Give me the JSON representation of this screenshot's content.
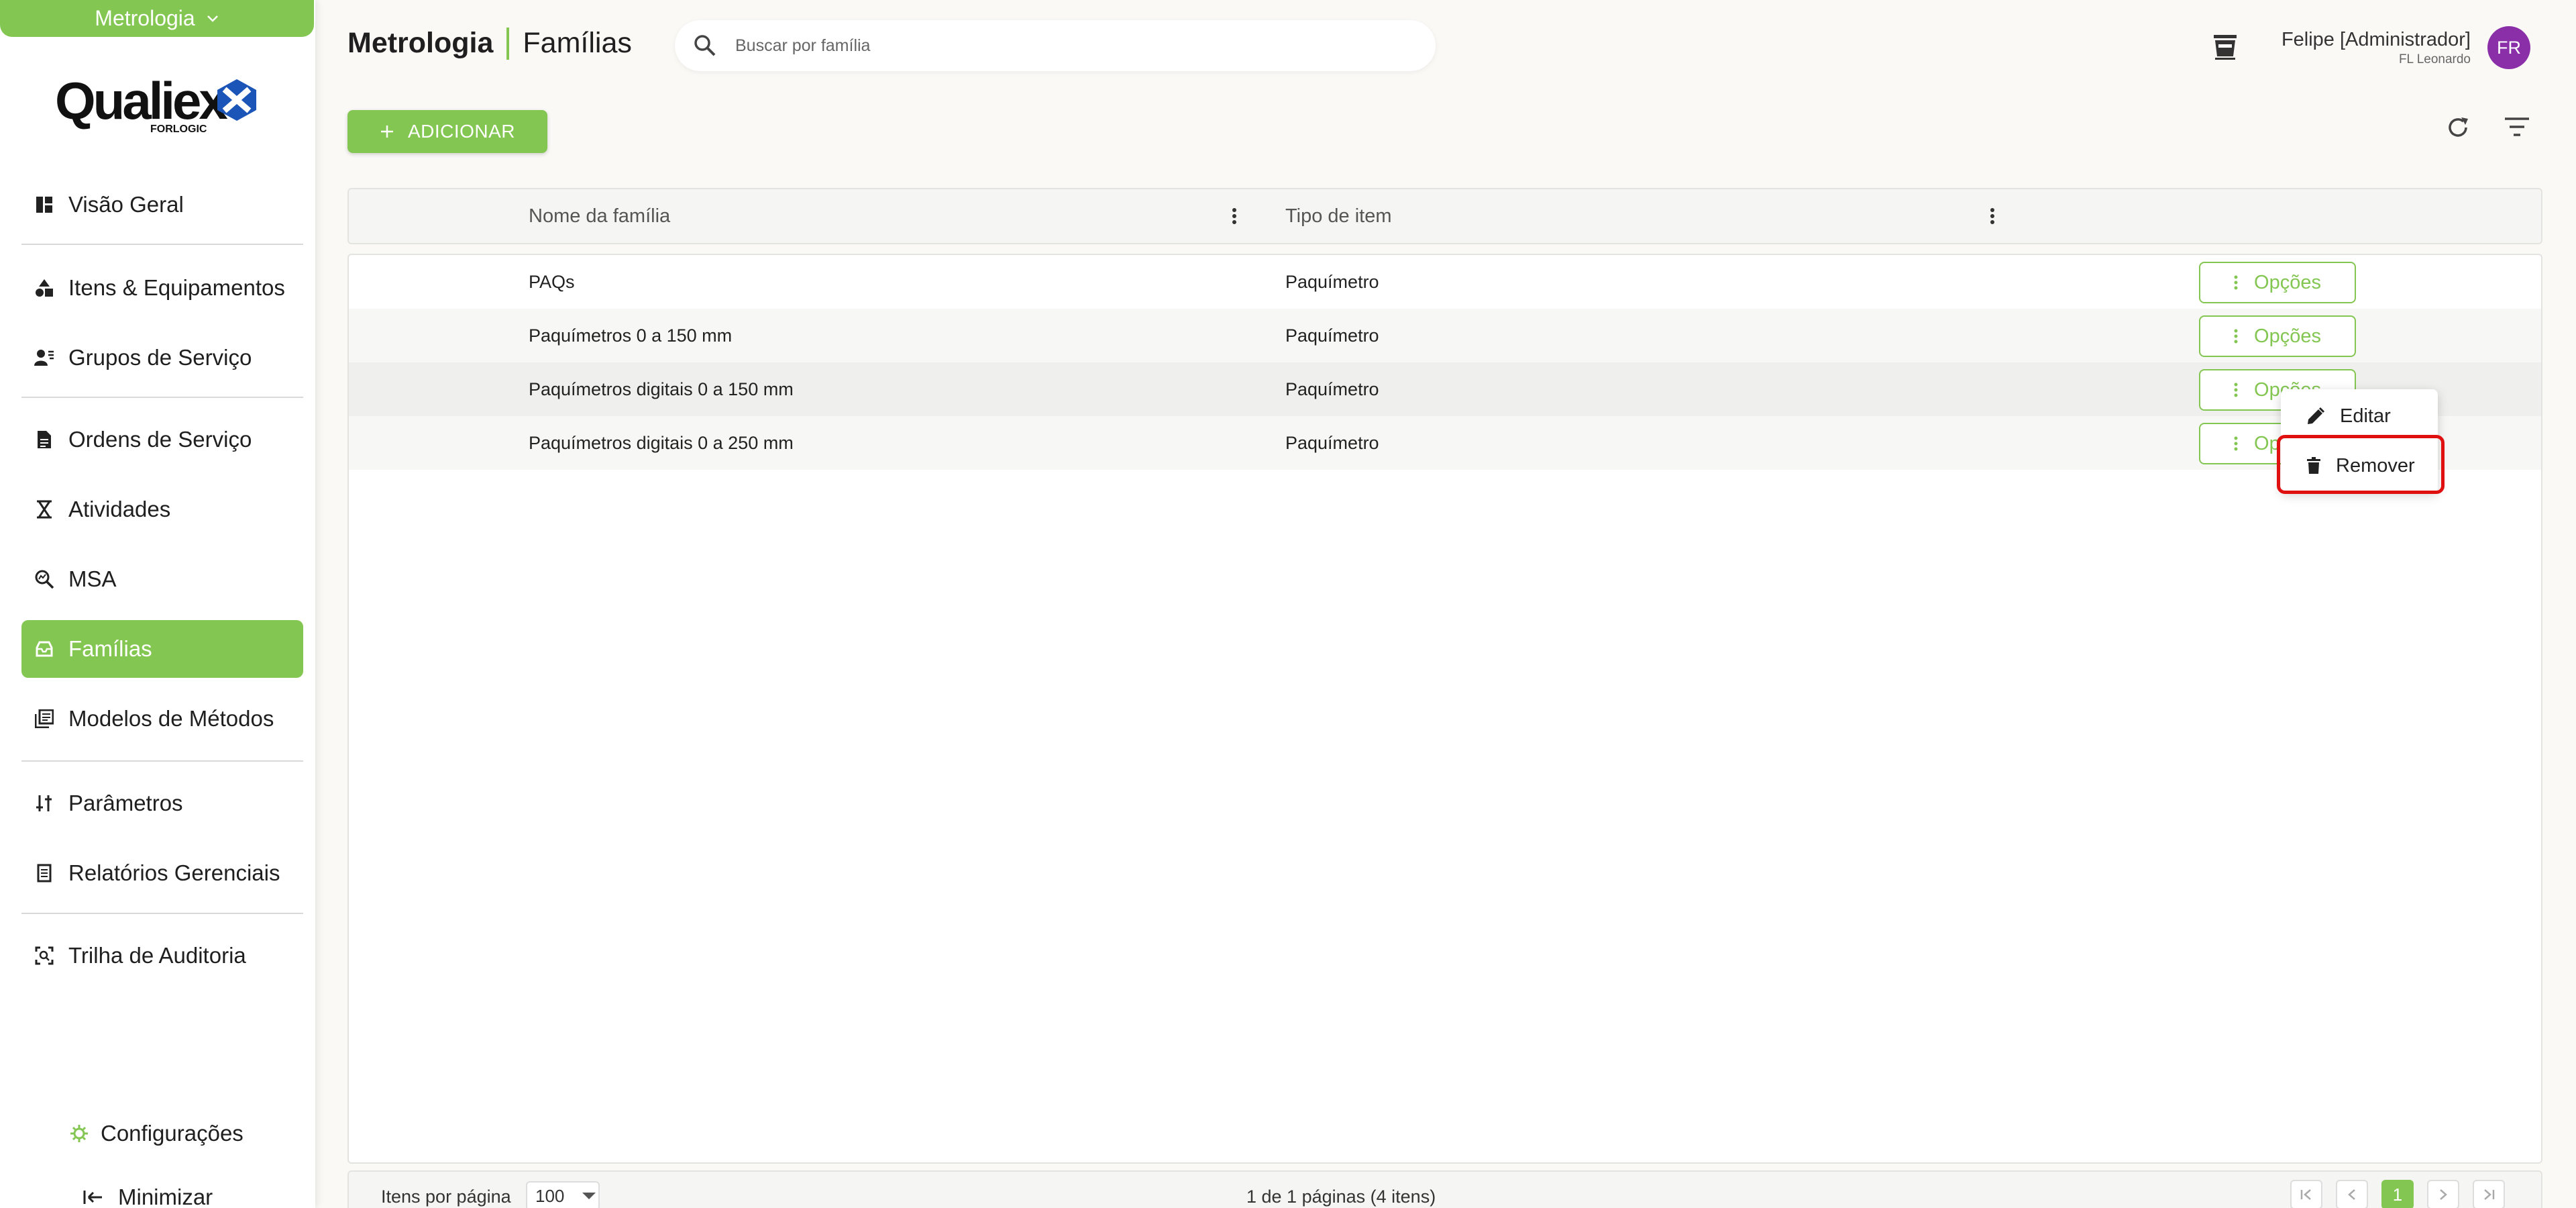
{
  "sidebar": {
    "module_switch": "Metrologia",
    "logo_text": "Qualiex",
    "logo_sub": "FORLOGIC",
    "items": [
      {
        "label": "Visão Geral",
        "icon": "dashboard-icon"
      },
      {
        "label": "Itens & Equipamentos",
        "icon": "shapes-icon"
      },
      {
        "label": "Grupos de Serviço",
        "icon": "user-group-icon"
      },
      {
        "label": "Ordens de Serviço",
        "icon": "document-icon"
      },
      {
        "label": "Atividades",
        "icon": "hourglass-icon"
      },
      {
        "label": "MSA",
        "icon": "magnify-chart-icon"
      },
      {
        "label": "Famílias",
        "icon": "tray-icon",
        "active": true
      },
      {
        "label": "Modelos de Métodos",
        "icon": "library-icon"
      },
      {
        "label": "Parâmetros",
        "icon": "tune-icon"
      },
      {
        "label": "Relatórios Gerenciais",
        "icon": "report-icon"
      },
      {
        "label": "Trilha de Auditoria",
        "icon": "audit-icon"
      }
    ],
    "config_label": "Configurações",
    "minimize_label": "Minimizar"
  },
  "header": {
    "module": "Metrologia",
    "page": "Famílias",
    "search_placeholder": "Buscar por família",
    "user_name": "Felipe [Administrador]",
    "user_company": "FL Leonardo",
    "avatar_initials": "FR"
  },
  "toolbar": {
    "add_label": "ADICIONAR"
  },
  "table": {
    "columns": [
      "Nome da família",
      "Tipo de item"
    ],
    "rows": [
      {
        "name": "PAQs",
        "type": "Paquímetro"
      },
      {
        "name": "Paquímetros 0 a 150 mm",
        "type": "Paquímetro"
      },
      {
        "name": "Paquímetros digitais 0 a 150 mm",
        "type": "Paquímetro"
      },
      {
        "name": "Paquímetros digitais 0 a 250 mm",
        "type": "Paquímetro"
      }
    ],
    "options_label": "Opções"
  },
  "options_menu": {
    "edit_label": "Editar",
    "remove_label": "Remover"
  },
  "footer": {
    "per_page_label": "Itens por página",
    "per_page_value": "100",
    "page_info": "1 de 1 páginas (4 itens)",
    "current_page": "1"
  },
  "colors": {
    "accent": "#83c652",
    "highlight": "#e01010",
    "avatar": "#8a2fa8"
  }
}
